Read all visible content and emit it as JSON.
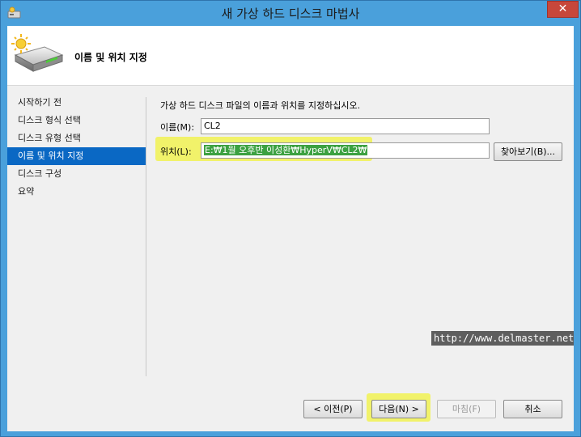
{
  "window": {
    "title": "새 가상 하드 디스크 마법사",
    "close_label": "✕"
  },
  "header": {
    "title": "이름 및 위치 지정",
    "icon": "virtual-hard-disk-icon"
  },
  "nav": {
    "items": [
      {
        "label": "시작하기 전"
      },
      {
        "label": "디스크 형식 선택"
      },
      {
        "label": "디스크 유형 선택"
      },
      {
        "label": "이름 및 위치 지정",
        "active": true
      },
      {
        "label": "디스크 구성"
      },
      {
        "label": "요약"
      }
    ]
  },
  "form": {
    "description": "가상 하드 디스크 파일의 이름과 위치를 지정하십시오.",
    "name_label": "이름(M):",
    "name_value": "CL2",
    "location_label": "위치(L):",
    "location_value": "E:₩1월 오후반 이성환₩HyperV₩CL2₩",
    "browse_label": "찾아보기(B)..."
  },
  "watermark": "http://www.delmaster.net",
  "buttons": {
    "prev": "< 이전(P)",
    "next": "다음(N) >",
    "finish": "마침(F)",
    "cancel": "취소"
  },
  "colors": {
    "highlight": "#f1f26a",
    "nav_active": "#0a68c4",
    "title_bar": "#4aa0db"
  }
}
